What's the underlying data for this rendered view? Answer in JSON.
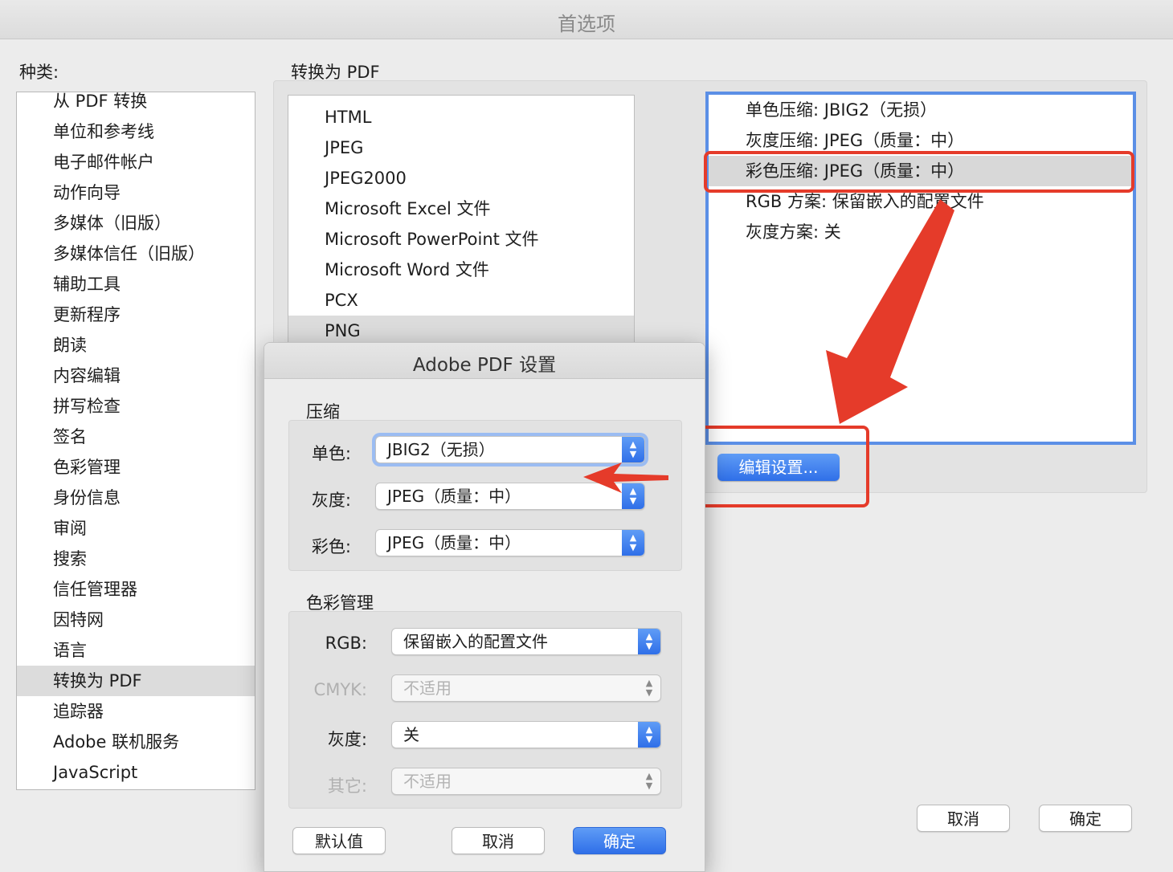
{
  "window": {
    "title": "首选项"
  },
  "categories": {
    "label": "种类:",
    "items": [
      {
        "label": "从 PDF 转换"
      },
      {
        "label": "单位和参考线"
      },
      {
        "label": "电子邮件帐户"
      },
      {
        "label": "动作向导"
      },
      {
        "label": "多媒体（旧版）"
      },
      {
        "label": "多媒体信任（旧版）"
      },
      {
        "label": "辅助工具"
      },
      {
        "label": "更新程序"
      },
      {
        "label": "朗读"
      },
      {
        "label": "内容编辑"
      },
      {
        "label": "拼写检查"
      },
      {
        "label": "签名"
      },
      {
        "label": "色彩管理"
      },
      {
        "label": "身份信息"
      },
      {
        "label": "审阅"
      },
      {
        "label": "搜索"
      },
      {
        "label": "信任管理器"
      },
      {
        "label": "因特网"
      },
      {
        "label": "语言"
      },
      {
        "label": "转换为 PDF",
        "selected": true
      },
      {
        "label": "追踪器"
      },
      {
        "label": "Adobe 联机服务"
      },
      {
        "label": "JavaScript"
      }
    ]
  },
  "convert": {
    "heading": "转换为 PDF",
    "formats": [
      {
        "label": "HTML"
      },
      {
        "label": "JPEG"
      },
      {
        "label": "JPEG2000"
      },
      {
        "label": "Microsoft Excel 文件"
      },
      {
        "label": "Microsoft PowerPoint 文件"
      },
      {
        "label": "Microsoft Word 文件"
      },
      {
        "label": "PCX"
      },
      {
        "label": "PNG",
        "selected": true
      }
    ],
    "settings": [
      {
        "label": "单色压缩: JBIG2（无损）"
      },
      {
        "label": "灰度压缩: JPEG（质量：中）"
      },
      {
        "label": "彩色压缩: JPEG（质量：中）",
        "selected": true
      },
      {
        "label": "RGB 方案: 保留嵌入的配置文件"
      },
      {
        "label": "灰度方案: 关"
      }
    ],
    "edit_button": "编辑设置..."
  },
  "footer": {
    "cancel": "取消",
    "ok": "确定"
  },
  "dialog": {
    "title": "Adobe PDF 设置",
    "compression": {
      "heading": "压缩",
      "mono_label": "单色:",
      "mono_value": "JBIG2（无损）",
      "gray_label": "灰度:",
      "gray_value": "JPEG（质量：中）",
      "color_label": "彩色:",
      "color_value": "JPEG（质量：中）"
    },
    "color_management": {
      "heading": "色彩管理",
      "rgb_label": "RGB:",
      "rgb_value": "保留嵌入的配置文件",
      "cmyk_label": "CMYK:",
      "cmyk_value": "不适用",
      "gray_label": "灰度:",
      "gray_value": "关",
      "other_label": "其它:",
      "other_value": "不适用"
    },
    "buttons": {
      "defaults": "默认值",
      "cancel": "取消",
      "ok": "确定"
    }
  },
  "colors": {
    "accent": "#2f6fe8",
    "annotation": "#e53b2a",
    "selection": "#dcdcdc"
  }
}
